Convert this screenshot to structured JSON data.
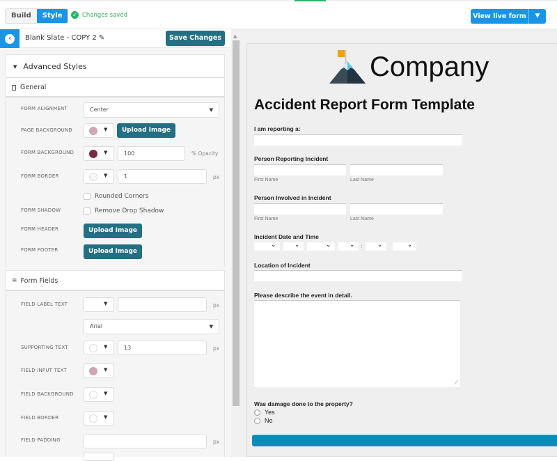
{
  "topbar": {
    "tabs": [
      {
        "label": "Build",
        "active": false
      },
      {
        "label": "Style",
        "active": true
      }
    ],
    "status": "Changes saved",
    "view_live_label": "View live form"
  },
  "editor": {
    "form_name": "Blank Slate - COPY 2",
    "save_label": "Save Changes",
    "advanced_title": "Advanced Styles",
    "general": {
      "title": "General",
      "form_alignment": {
        "label": "FORM ALIGNMENT",
        "value": "Center"
      },
      "page_background": {
        "label": "PAGE BACKGROUND",
        "color": "#d1a5b4",
        "button": "Upload Image"
      },
      "form_background": {
        "label": "FORM BACKGROUND",
        "color": "#7b2a45",
        "opacity": "100",
        "unit": "% Opacity"
      },
      "form_border": {
        "label": "FORM BORDER",
        "color": "transparent",
        "width": "1",
        "unit": "px",
        "rounded_corners": "Rounded Corners"
      },
      "form_shadow": {
        "label": "FORM SHADOW",
        "option": "Remove Drop Shadow"
      },
      "form_header": {
        "label": "FORM HEADER",
        "button": "Upload Image"
      },
      "form_footer": {
        "label": "FORM FOOTER",
        "button": "Upload Image"
      }
    },
    "form_fields": {
      "title": "Form Fields",
      "field_label_text": {
        "label": "FIELD LABEL TEXT",
        "size": "",
        "unit": "px",
        "font": "Arial"
      },
      "supporting_text": {
        "label": "SUPPORTING TEXT",
        "color": "#ffffff",
        "size": "13",
        "unit": "px"
      },
      "field_input_text": {
        "label": "FIELD INPUT TEXT",
        "color": "#d1a5b4"
      },
      "field_background": {
        "label": "FIELD BACKGROUND",
        "color": "#ffffff"
      },
      "field_border": {
        "label": "FIELD BORDER",
        "color": "#ffffff"
      },
      "field_padding": {
        "label": "FIELD PADDING",
        "value": "",
        "unit": "px"
      }
    }
  },
  "preview": {
    "company": "Company",
    "title": "Accident Report Form Template",
    "q_reporting": "I am reporting a:",
    "q_person_reporting": "Person Reporting Incident",
    "q_person_involved": "Person Involved in Incident",
    "first_name": "First Name",
    "last_name": "Last Name",
    "q_datetime": "Incident Date and Time",
    "colon": ":",
    "q_location": "Location of Incident",
    "q_describe": "Please describe the event in detail.",
    "q_damage": "Was damage done to the property?",
    "options": [
      "Yes",
      "No"
    ]
  },
  "icons": {
    "check": "✓",
    "back": "‹",
    "pencil": "✎",
    "caret": "▼",
    "chevron": "⌄",
    "up": "▲",
    "grip": "⟋"
  }
}
